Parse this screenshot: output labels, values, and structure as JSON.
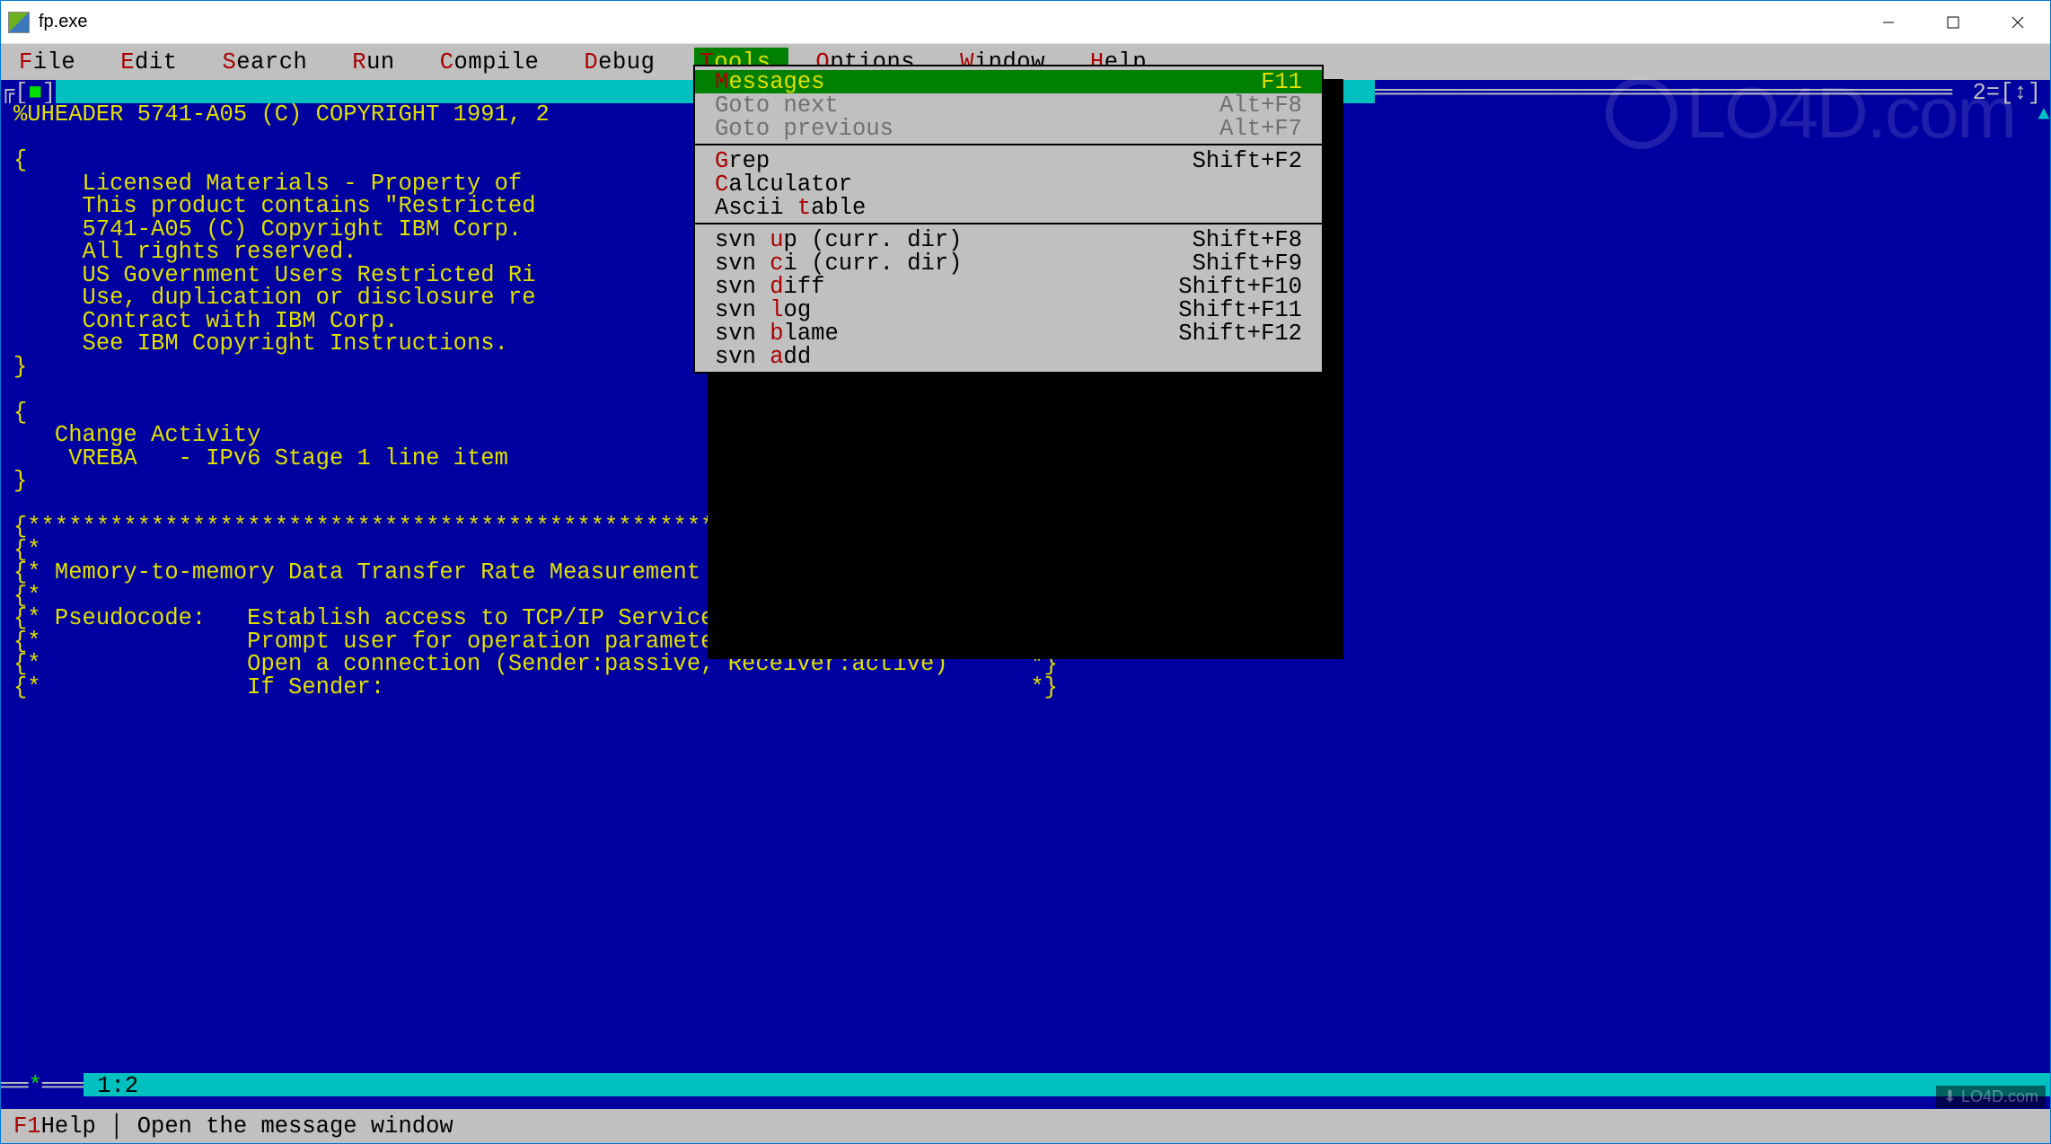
{
  "window": {
    "title": "fp.exe"
  },
  "menubar": [
    {
      "hot": "F",
      "rest": "ile"
    },
    {
      "hot": "E",
      "rest": "dit"
    },
    {
      "hot": "S",
      "rest": "earch"
    },
    {
      "hot": "R",
      "rest": "un"
    },
    {
      "hot": "C",
      "rest": "ompile"
    },
    {
      "hot": "D",
      "rest": "ebug"
    },
    {
      "hot": "T",
      "rest": "ools",
      "open": true
    },
    {
      "hot": "O",
      "rest": "ptions"
    },
    {
      "hot": "W",
      "rest": "indow"
    },
    {
      "hot": "H",
      "rest": "elp"
    }
  ],
  "dropdown": {
    "groups": [
      [
        {
          "pre": "",
          "hot": "M",
          "post": "essages",
          "shortcut": "F11",
          "sel": true
        },
        {
          "pre": "Goto ",
          "hot": "n",
          "post": "ext",
          "shortcut": "Alt+F8",
          "disabled": true
        },
        {
          "pre": "Goto ",
          "hot": "p",
          "post": "revious",
          "shortcut": "Alt+F7",
          "disabled": true
        }
      ],
      [
        {
          "pre": "",
          "hot": "G",
          "post": "rep",
          "shortcut": "Shift+F2"
        },
        {
          "pre": "",
          "hot": "C",
          "post": "alculator",
          "shortcut": ""
        },
        {
          "pre": "Ascii ",
          "hot": "t",
          "post": "able",
          "shortcut": ""
        }
      ],
      [
        {
          "pre": "svn ",
          "hot": "u",
          "post": "p (curr. dir)",
          "shortcut": "Shift+F8"
        },
        {
          "pre": "svn ",
          "hot": "c",
          "post": "i (curr. dir)",
          "shortcut": "Shift+F9"
        },
        {
          "pre": "svn ",
          "hot": "d",
          "post": "iff",
          "shortcut": "Shift+F10"
        },
        {
          "pre": "svn ",
          "hot": "l",
          "post": "og",
          "shortcut": "Shift+F11"
        },
        {
          "pre": "svn ",
          "hot": "b",
          "post": "lame",
          "shortcut": "Shift+F12"
        },
        {
          "pre": "svn ",
          "hot": "a",
          "post": "dd",
          "shortcut": ""
        }
      ]
    ]
  },
  "frame": {
    "indicator": "2=[↕]",
    "cursor_pos": " 1:2 ",
    "modified": "*"
  },
  "code": "%UHEADER 5741-A05 (C) COPYRIGHT 1991, 2\n\n{\n     Licensed Materials - Property of\n     This product contains \"Restricted\n     5741-A05 (C) Copyright IBM Corp.\n     All rights reserved.\n     US Government Users Restricted Ri\n     Use, duplication or disclosure re\n     Contract with IBM Corp.\n     See IBM Copyright Instructions.\n}\n\n{\n   Change Activity\n    VREBA   - IPv6 Stage 1 line item\n}\n\n{**************************************************************************}\n{*                                                                        *}\n{* Memory-to-memory Data Transfer Rate Measurement                        *}\n{*                                                                        *}\n{* Pseudocode:   Establish access to TCP/IP Services                      *}\n{*               Prompt user for operation parameters                     *}\n{*               Open a connection (Sender:passive, Receiver:active)      *}\n{*               If Sender:                                               *}",
  "statusbar": {
    "key": "F1",
    "text": " Help  │  Open the message window"
  },
  "watermark": "LO4D.com",
  "footer_watermark": "⬇ LO4D.com"
}
